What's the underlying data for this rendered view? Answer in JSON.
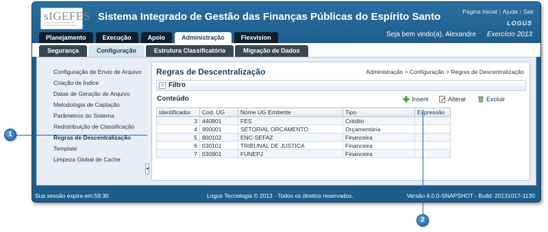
{
  "header": {
    "logo_text": "sIGEFES",
    "logo_subtext": "Sistema Integrado de Gestão das Finanças Públicas do Espírito Santo",
    "title": "Sistema Integrado de Gestão das Finanças Públicas do Espírito Santo",
    "links": [
      "Página Inicial",
      "Ajuda",
      "Sair"
    ],
    "brand": "LOGUS",
    "welcome": "Seja bem vindo(a), Alexandre",
    "year": "Exercício 2013"
  },
  "main_tabs": [
    "Planejamento",
    "Execução",
    "Apoio",
    "Administração",
    "Flexvision"
  ],
  "active_main_tab": "Administração",
  "sub_tabs": [
    "Segurança",
    "Configuração",
    "Estrutura Classificatória",
    "Migração de Dados"
  ],
  "active_sub_tab": "Configuração",
  "sidebar": {
    "items": [
      "Configuração de Envio de Arquivo",
      "Criação de Índice",
      "Datas de Geração de Arquivo",
      "Metodologia de Captação",
      "Parâmetros do Sistema",
      "Redistribuição de Classificação",
      "Regras de Descentralização",
      "Template",
      "Limpeza Global de Cache"
    ],
    "active": "Regras de Descentralização",
    "collapse_glyph": "◂"
  },
  "page": {
    "title": "Regras de Descentralização",
    "breadcrumb": "Administração > Configuração > Regras de Descentralização",
    "filter_label": "Filtro",
    "filter_toggle": ">",
    "content_label": "Conteúdo",
    "actions": {
      "insert": "Inserir",
      "edit": "Alterar",
      "delete": "Excluir"
    },
    "icons": {
      "insert": "plus-icon",
      "edit": "edit-icon",
      "delete": "trash-icon"
    }
  },
  "table": {
    "columns": [
      "Identificador",
      "Cod. UG",
      "Nome UG Emitente",
      "Tipo",
      "Expressão"
    ],
    "rows": [
      [
        "3",
        "440901",
        "FES",
        "Crédito",
        ""
      ],
      [
        "4",
        "900001",
        "SETORIAL ORCAMENTO",
        "Orçamentária",
        ""
      ],
      [
        "5",
        "800102",
        "ENC-SEFAZ",
        "Financeira",
        ""
      ],
      [
        "6",
        "030101",
        "TRIBUNAL DE JUSTICA",
        "Financeira",
        ""
      ],
      [
        "7",
        "030901",
        "FUNEPJ",
        "Financeira",
        ""
      ]
    ]
  },
  "footer": {
    "session": "Sua sessão expira em:59:30",
    "copyright": "Logus Tecnologia © 2013 - Todos os direitos reservados.",
    "version": "Versão 4.0.0-SNAPSHOT - Build: 20131017-1130"
  },
  "callouts": [
    "1",
    "2"
  ],
  "colors": {
    "header_blue": "#1d5d8c",
    "tab_dark": "#0f1f2e",
    "callout_blue": "#1f5fa8"
  }
}
